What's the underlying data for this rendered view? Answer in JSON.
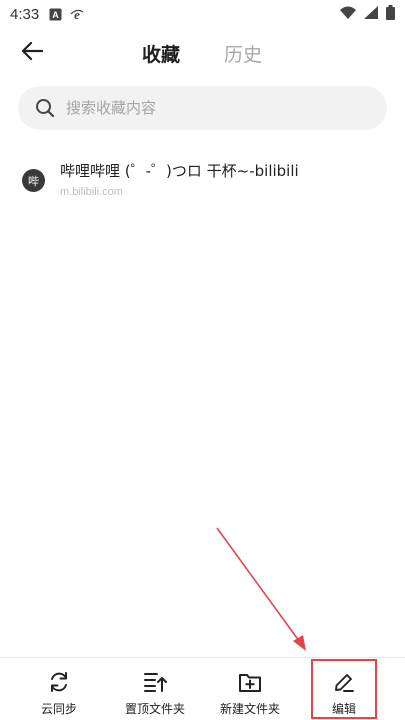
{
  "status_bar": {
    "time": "4:33",
    "left_icons": [
      "notification-a-icon",
      "browser-e-icon"
    ],
    "right_icons": [
      "wifi-icon",
      "signal-icon",
      "battery-icon"
    ]
  },
  "header": {
    "back_icon": "arrow-left-icon",
    "tabs": [
      {
        "label": "收藏",
        "active": true
      },
      {
        "label": "历史",
        "active": false
      }
    ]
  },
  "search": {
    "icon": "search-icon",
    "placeholder": "搜索收藏内容"
  },
  "bookmarks": [
    {
      "favicon_text": "哔",
      "title": "哔哩哔哩 (゜-゜)つロ 干杯~-bilibili",
      "url": "m.bilibili.com"
    }
  ],
  "bottom_bar": {
    "items": [
      {
        "label": "云同步",
        "icon": "sync-icon"
      },
      {
        "label": "置顶文件夹",
        "icon": "pin-top-folder-icon"
      },
      {
        "label": "新建文件夹",
        "icon": "new-folder-icon"
      },
      {
        "label": "编辑",
        "icon": "edit-pencil-icon",
        "highlighted": true
      }
    ]
  },
  "colors": {
    "highlight": "#e0454a",
    "active_tab": "#1d1d1d",
    "inactive_tab": "#a8a8a8",
    "search_bg": "#f2f2f2"
  }
}
